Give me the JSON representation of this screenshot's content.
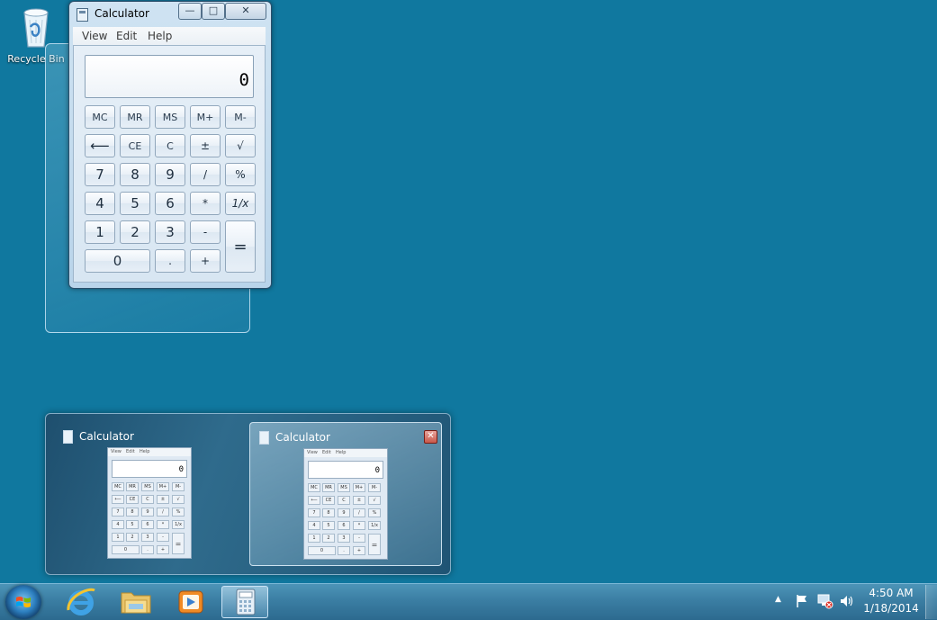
{
  "desktop": {
    "recycle_bin_label": "Recycle Bin"
  },
  "calculator": {
    "title": "Calculator",
    "controls": {
      "minimize": "—",
      "maximize": "□",
      "close": "✕"
    },
    "menu": [
      "View",
      "Edit",
      "Help"
    ],
    "display_value": "0",
    "keys": {
      "mc": "MC",
      "mr": "MR",
      "ms": "MS",
      "mplus": "M+",
      "mminus": "M-",
      "backspace": "⟵",
      "ce": "CE",
      "c": "C",
      "plusminus": "±",
      "sqrt": "√",
      "d7": "7",
      "d8": "8",
      "d9": "9",
      "divide": "/",
      "percent": "%",
      "d4": "4",
      "d5": "5",
      "d6": "6",
      "multiply": "*",
      "reciprocal": "1/x",
      "d1": "1",
      "d2": "2",
      "d3": "3",
      "minus": "-",
      "equals": "=",
      "d0": "0",
      "decimal": ".",
      "plus": "+"
    }
  },
  "thumbnails": [
    {
      "title": "Calculator",
      "display": "0",
      "has_close": false
    },
    {
      "title": "Calculator",
      "display": "0",
      "has_close": true,
      "close_label": "✕"
    }
  ],
  "mini_labels": {
    "menu": [
      "View",
      "Edit",
      "Help"
    ],
    "row1": [
      "MC",
      "MR",
      "MS",
      "M+",
      "M-"
    ],
    "row2": [
      "⟵",
      "CE",
      "C",
      "±",
      "√"
    ],
    "row3": [
      "7",
      "8",
      "9",
      "/",
      "%"
    ],
    "row4": [
      "4",
      "5",
      "6",
      "*",
      "1/x"
    ],
    "row5": [
      "1",
      "2",
      "3",
      "-"
    ],
    "row6": [
      "0",
      ".",
      "+"
    ],
    "equals": "="
  },
  "taskbar": {
    "pinned": [
      "start-button",
      "internet-explorer",
      "windows-explorer",
      "windows-media-player",
      "calculator"
    ],
    "tray_overflow": "▲",
    "time": "4:50 AM",
    "date": "1/18/2014"
  },
  "colors": {
    "desktop": "#10789f",
    "taskbar": "#2c6a8f",
    "window_frame": "#b9d4ea",
    "close_red": "#c8584a"
  }
}
